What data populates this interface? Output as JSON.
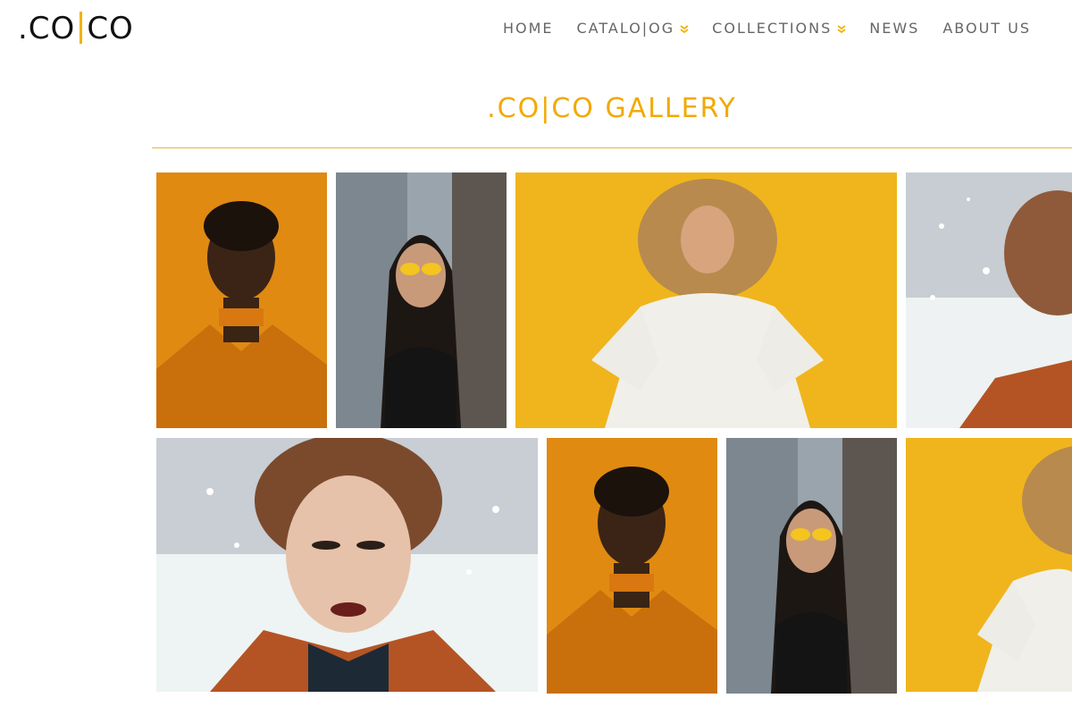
{
  "logo": {
    "left": ".CO",
    "right": "CO"
  },
  "nav": {
    "home": "HOME",
    "catalog": "CATALO|OG",
    "collections": "COLLECTIONS",
    "news": "NEWS",
    "about": "ABOUT US"
  },
  "gallery": {
    "title": ".CO|CO GALLERY"
  },
  "colors": {
    "accent": "#f2b300",
    "nav_text": "#666666",
    "title": "#f2a900"
  },
  "images": [
    {
      "name": "photo-1-orange-jacket-woman",
      "row": 1
    },
    {
      "name": "photo-2-yellow-glasses-woman",
      "row": 1
    },
    {
      "name": "photo-3-curly-hair-white-dress",
      "row": 1
    },
    {
      "name": "photo-4-snow-cropped",
      "row": 1
    },
    {
      "name": "photo-5-snow-closeup",
      "row": 2
    },
    {
      "name": "photo-6-orange-jacket-woman",
      "row": 2
    },
    {
      "name": "photo-7-yellow-glasses-woman",
      "row": 2
    },
    {
      "name": "photo-8-curly-hair-cropped",
      "row": 2
    }
  ]
}
